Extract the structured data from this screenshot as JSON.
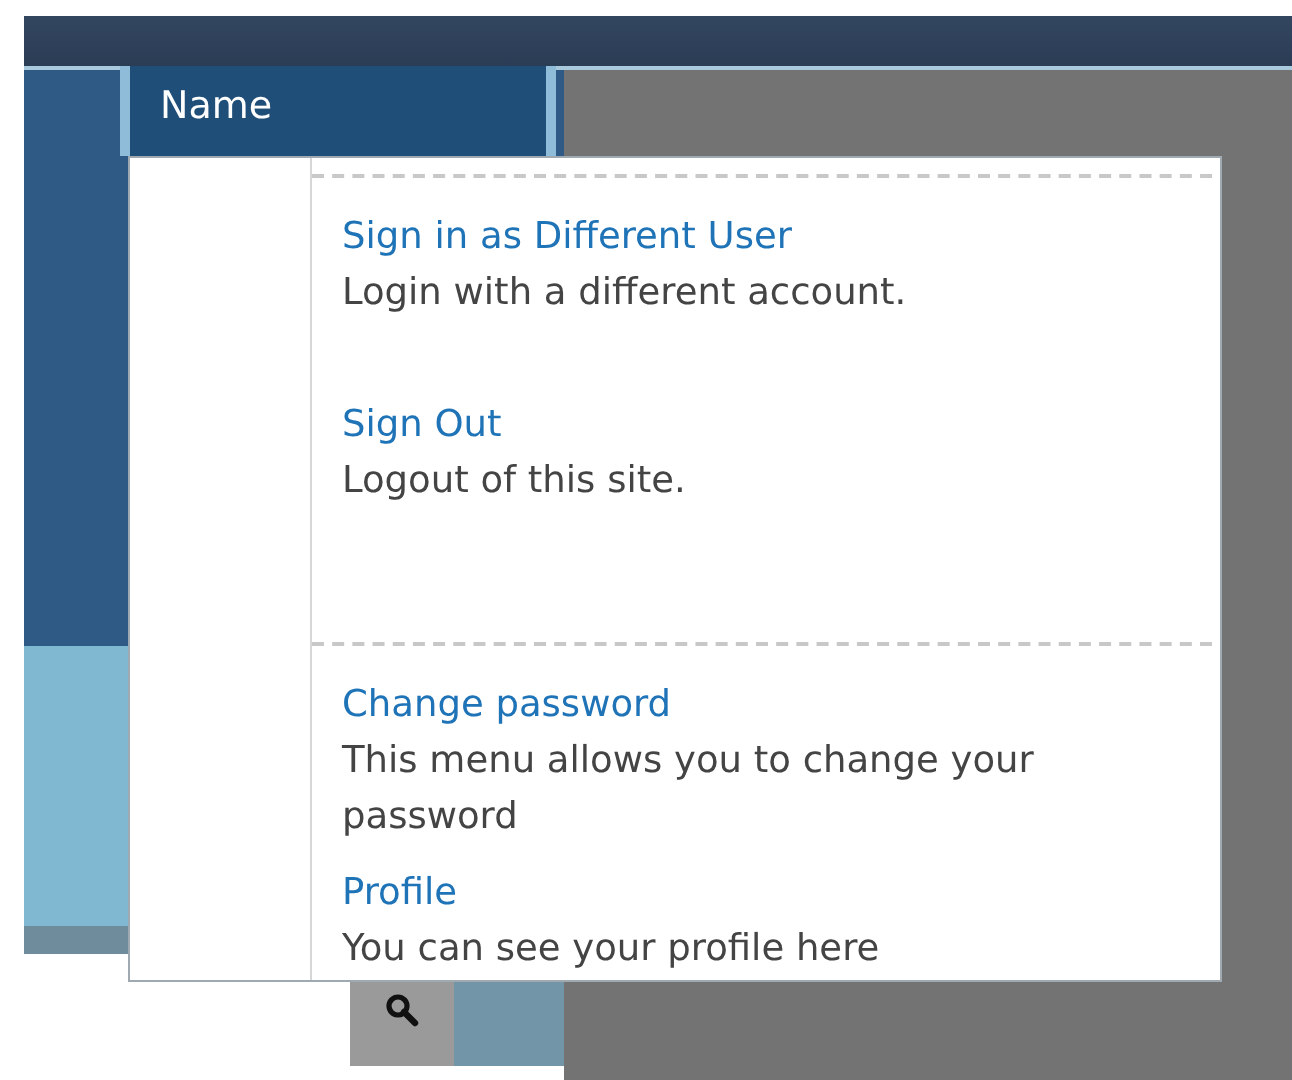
{
  "header_tab": {
    "label": "Name"
  },
  "menu": {
    "groups": [
      {
        "items": [
          {
            "title": "Sign in as Different User",
            "description": "Login with a different account."
          },
          {
            "title": "Sign Out",
            "description": "Logout of this site."
          }
        ]
      },
      {
        "items": [
          {
            "title": "Change password",
            "description": "This menu allows you to change your password"
          },
          {
            "title": "Profile",
            "description": "You can see your profile here"
          }
        ]
      }
    ]
  }
}
